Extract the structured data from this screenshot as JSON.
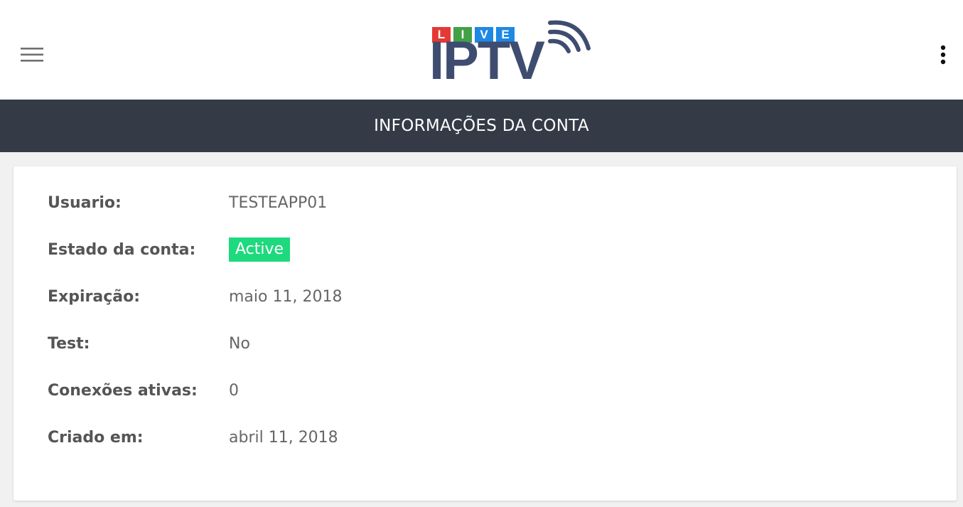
{
  "header": {
    "menu_icon": "hamburger-menu-icon",
    "more_icon": "more-vertical-icon",
    "logo": {
      "letters": [
        {
          "char": "L",
          "color": "#e53935"
        },
        {
          "char": "I",
          "color": "#43a047"
        },
        {
          "char": "V",
          "color": "#1e88e5"
        },
        {
          "char": "E",
          "color": "#1e88e5"
        }
      ],
      "main_text": "IPTV",
      "main_color": "#3e4d6f"
    }
  },
  "title_bar": {
    "title": "INFORMAÇÕES DA CONTA",
    "background": "#343b46"
  },
  "account": {
    "rows": [
      {
        "label": "Usuario:",
        "value": "TESTEAPP01"
      },
      {
        "label": "Estado da conta:",
        "value": "Active",
        "badge_color": "#1ed97d"
      },
      {
        "label": "Expiração:",
        "value": "maio 11, 2018"
      },
      {
        "label": "Test:",
        "value": "No"
      },
      {
        "label": "Conexões ativas:",
        "value": "0"
      },
      {
        "label": "Criado em:",
        "value": "abril 11, 2018"
      }
    ]
  }
}
